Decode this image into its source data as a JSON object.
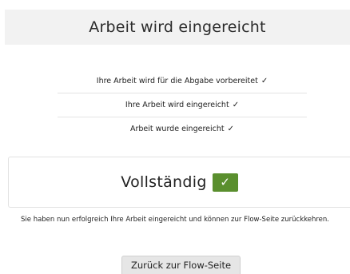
{
  "header": {
    "title": "Arbeit wird eingereicht"
  },
  "steps": [
    {
      "label": "Ihre Arbeit wird für die Abgabe vorbereitet",
      "check": "✓"
    },
    {
      "label": "Ihre Arbeit wird eingereicht",
      "check": "✓"
    },
    {
      "label": "Arbeit wurde eingereicht",
      "check": "✓"
    }
  ],
  "status": {
    "label": "Vollständig",
    "check": "✓",
    "check_color": "#5a8f2e"
  },
  "message": "Sie haben nun erfolgreich Ihre Arbeit eingereicht und können zur Flow-Seite zurückkehren.",
  "back_button": {
    "label": "Zurück zur Flow-Seite"
  }
}
